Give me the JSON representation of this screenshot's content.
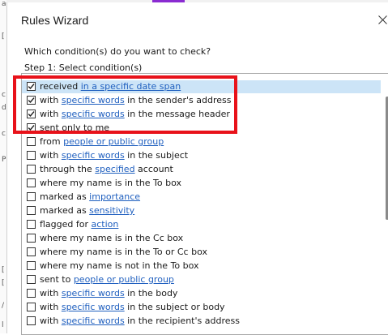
{
  "background": {
    "side_fragments": [
      "a",
      "[",
      "c",
      "d",
      "c",
      "P",
      "[",
      "[",
      "/",
      "l"
    ]
  },
  "dialog": {
    "title": "Rules Wizard",
    "question": "Which condition(s) do you want to check?",
    "step_label": "Step 1: Select condition(s)"
  },
  "conditions": [
    {
      "prefix": "received ",
      "link": "in a specific date span",
      "suffix": "",
      "checked": true,
      "selected": true
    },
    {
      "prefix": "with ",
      "link": "specific words",
      "suffix": " in the sender's address",
      "checked": true,
      "selected": false
    },
    {
      "prefix": "with ",
      "link": "specific words",
      "suffix": " in the message header",
      "checked": true,
      "selected": false
    },
    {
      "prefix": "sent only to me",
      "link": "",
      "suffix": "",
      "checked": true,
      "selected": false
    },
    {
      "prefix": "from ",
      "link": "people or public group",
      "suffix": "",
      "checked": false,
      "selected": false
    },
    {
      "prefix": "with ",
      "link": "specific words",
      "suffix": " in the subject",
      "checked": false,
      "selected": false
    },
    {
      "prefix": "through the ",
      "link": "specified",
      "suffix": " account",
      "checked": false,
      "selected": false
    },
    {
      "prefix": "where my name is in the To box",
      "link": "",
      "suffix": "",
      "checked": false,
      "selected": false
    },
    {
      "prefix": "marked as ",
      "link": "importance",
      "suffix": "",
      "checked": false,
      "selected": false
    },
    {
      "prefix": "marked as ",
      "link": "sensitivity",
      "suffix": "",
      "checked": false,
      "selected": false
    },
    {
      "prefix": "flagged for ",
      "link": "action",
      "suffix": "",
      "checked": false,
      "selected": false
    },
    {
      "prefix": "where my name is in the Cc box",
      "link": "",
      "suffix": "",
      "checked": false,
      "selected": false
    },
    {
      "prefix": "where my name is in the To or Cc box",
      "link": "",
      "suffix": "",
      "checked": false,
      "selected": false
    },
    {
      "prefix": "where my name is not in the To box",
      "link": "",
      "suffix": "",
      "checked": false,
      "selected": false
    },
    {
      "prefix": "sent to ",
      "link": "people or public group",
      "suffix": "",
      "checked": false,
      "selected": false
    },
    {
      "prefix": "with ",
      "link": "specific words",
      "suffix": " in the body",
      "checked": false,
      "selected": false
    },
    {
      "prefix": "with ",
      "link": "specific words",
      "suffix": " in the subject or body",
      "checked": false,
      "selected": false
    },
    {
      "prefix": "with ",
      "link": "specific words",
      "suffix": " in the recipient's address",
      "checked": false,
      "selected": false
    }
  ],
  "colors": {
    "link": "#1f5fbf",
    "selection": "#cce4f7",
    "annotation_box": "#e8121a",
    "scroll_thumb": "#8a8a8a"
  },
  "scroll": {
    "thumb_position": 0.09,
    "thumb_fraction": 0.47
  }
}
